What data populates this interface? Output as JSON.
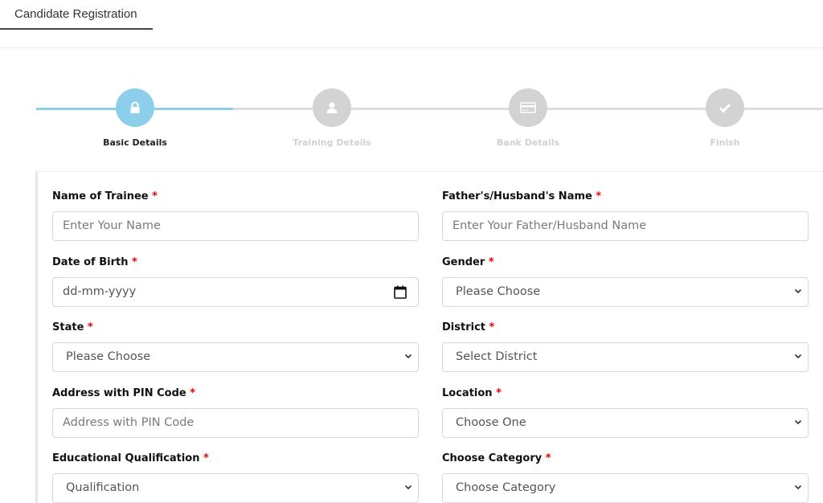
{
  "tab": {
    "label": "Candidate Registration"
  },
  "stepper": {
    "active_color": "#8dcfeb",
    "inactive_color": "#d3d3d3",
    "steps": [
      {
        "label": "Basic Details",
        "icon": "lock-icon",
        "active": true
      },
      {
        "label": "Training Details",
        "icon": "user-icon",
        "active": false
      },
      {
        "label": "Bank Details",
        "icon": "credit-card-icon",
        "active": false
      },
      {
        "label": "Finish",
        "icon": "check-icon",
        "active": false
      }
    ]
  },
  "form": {
    "fields": [
      {
        "label": "Name of Trainee",
        "type": "text",
        "placeholder": "Enter Your Name"
      },
      {
        "label": "Father's/Husband's Name",
        "type": "text",
        "placeholder": "Enter Your Father/Husband Name"
      },
      {
        "label": "Date of Birth",
        "type": "date",
        "placeholder": "dd-mm-yyyy"
      },
      {
        "label": "Gender",
        "type": "select",
        "value": "Please Choose"
      },
      {
        "label": "State",
        "type": "select",
        "value": "Please Choose"
      },
      {
        "label": "District",
        "type": "select",
        "value": "Select District"
      },
      {
        "label": "Address with PIN Code",
        "type": "text",
        "placeholder": "Address with PIN Code"
      },
      {
        "label": "Location",
        "type": "select",
        "value": "Choose One"
      },
      {
        "label": "Educational Qualification",
        "type": "select",
        "value": "Qualification"
      },
      {
        "label": "Choose Category",
        "type": "select",
        "value": "Choose Category"
      }
    ],
    "required_mark": "*"
  }
}
